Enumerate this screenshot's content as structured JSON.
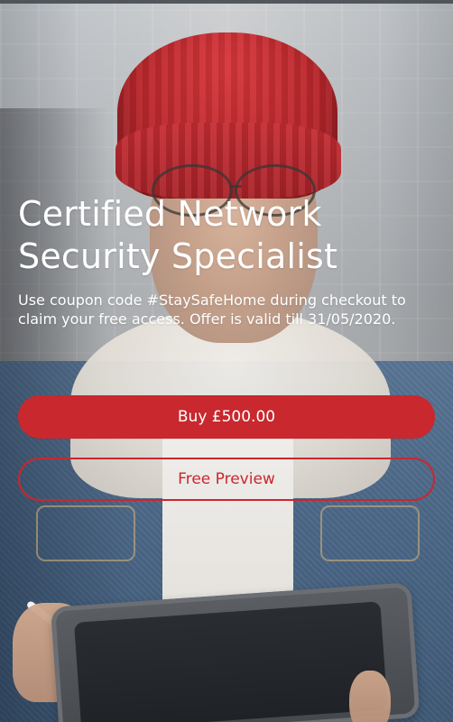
{
  "hero": {
    "title_line_1": "Certified Network",
    "title_line_2": "Security Specialist",
    "description": "Use coupon code #StaySafeHome during checkout to claim your free access. Offer is valid till 31/05/2020."
  },
  "actions": {
    "buy_label": "Buy £500.00",
    "preview_label": "Free Preview"
  },
  "theme": {
    "accent": "#c8282e",
    "text": "#ffffff"
  }
}
